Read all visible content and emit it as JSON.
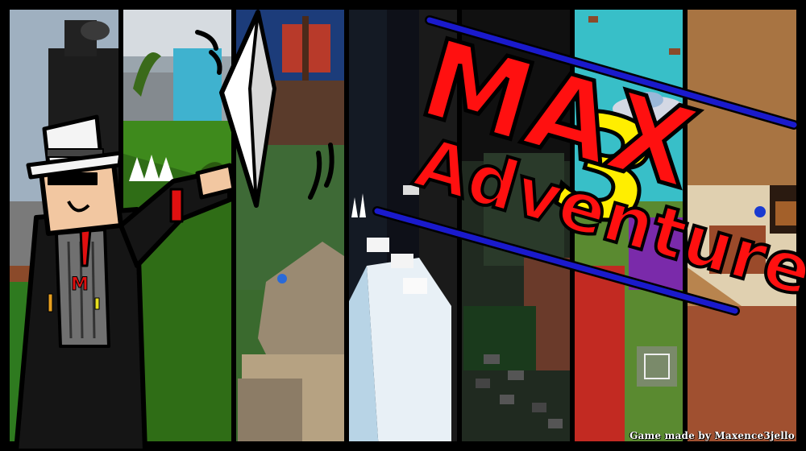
{
  "banner": {
    "title": "MAX",
    "subtitle": "Adventure",
    "number": "3",
    "credit": "Game made by Maxence3jello"
  },
  "colors": {
    "title_red": "#ff1010",
    "number_yellow": "#ffee00",
    "stripe_blue": "#1a1acc",
    "divider": "#000000"
  },
  "panels": [
    {
      "name": "panel-tower-sky"
    },
    {
      "name": "panel-waterfall-jungle"
    },
    {
      "name": "panel-pirate-island"
    },
    {
      "name": "panel-snow-obby"
    },
    {
      "name": "panel-dark-dungeon"
    },
    {
      "name": "panel-ufo-sky"
    },
    {
      "name": "panel-desert-temple"
    }
  ],
  "icons": [
    "crystal-icon",
    "gangster-character-icon"
  ]
}
